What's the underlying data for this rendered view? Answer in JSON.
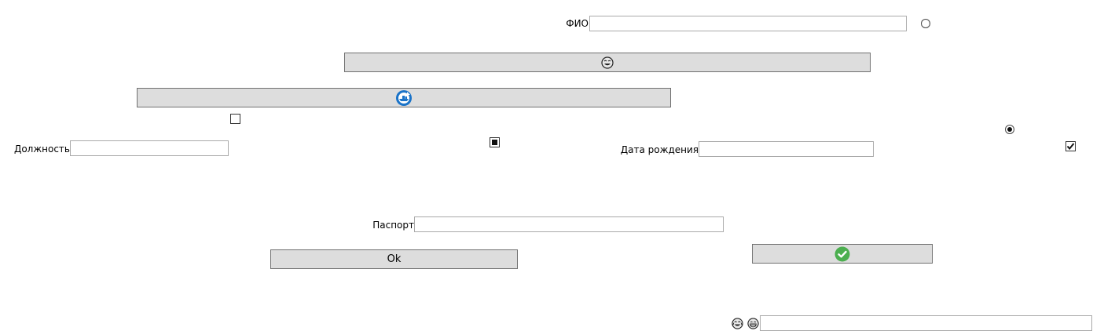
{
  "fields": {
    "fio": {
      "label": "ФИО",
      "value": ""
    },
    "position": {
      "label": "Должность",
      "value": ""
    },
    "birthdate": {
      "label": "Дата рождения",
      "value": ""
    },
    "passport": {
      "label": "Паспорт",
      "value": ""
    },
    "bottom": {
      "value": ""
    }
  },
  "buttons": {
    "emoji_button": {
      "icon": "laughing-face-icon"
    },
    "share_button": {
      "icon": "ship-emblem-icon",
      "color": "#1a73c8"
    },
    "ok_button": {
      "label": "Ok"
    },
    "check_button": {
      "icon": "green-check-icon",
      "color": "#4caf50"
    }
  },
  "toggles": {
    "radio_top": {
      "checked": false
    },
    "radio_right": {
      "checked": true
    },
    "checkbox_left": {
      "checked": false
    },
    "checkbox_middle": {
      "state": "indeterminate"
    },
    "checkbox_right": {
      "checked": true
    }
  },
  "bottom_icons": [
    "crying-laughing-face-icon",
    "grinning-face-icon"
  ]
}
